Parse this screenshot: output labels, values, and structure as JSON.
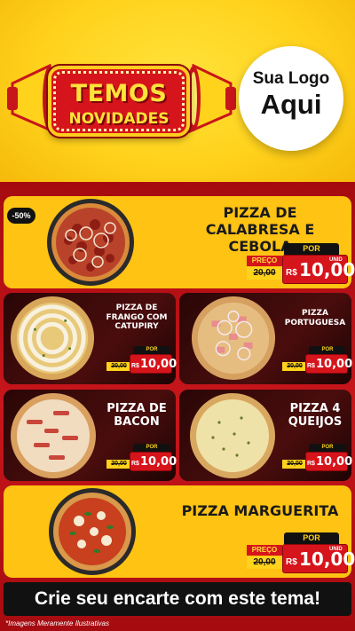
{
  "badge": {
    "line1": "TEMOS",
    "line2": "NOVIDADES"
  },
  "logo": {
    "line1": "Sua Logo",
    "line2": "Aqui"
  },
  "discount_label": "-50%",
  "price_labels": {
    "por": "POR",
    "preco": "PREÇO",
    "currency": "R$",
    "unid": "UNID"
  },
  "products": [
    {
      "name": "PIZZA DE CALABRESA E CEBOLA",
      "old_price": "20,00",
      "price": "10,00"
    },
    {
      "name": "PIZZA DE FRANGO COM CATUPIRY",
      "old_price": "20,00",
      "price": "10,00"
    },
    {
      "name": "PIZZA PORTUGUESA",
      "old_price": "20,00",
      "price": "10,00"
    },
    {
      "name": "PIZZA DE BACON",
      "old_price": "20,00",
      "price": "10,00"
    },
    {
      "name": "PIZZA 4 QUEIJOS",
      "old_price": "20,00",
      "price": "10,00"
    },
    {
      "name": "PIZZA MARGUERITA",
      "old_price": "20,00",
      "price": "10,00"
    }
  ],
  "cta": "Crie seu encarte com este tema!",
  "footnote": "*Imagens Meramente Ilustrativas",
  "colors": {
    "yellow": "#ffd21c",
    "red": "#d6141b",
    "dark": "#111111"
  }
}
